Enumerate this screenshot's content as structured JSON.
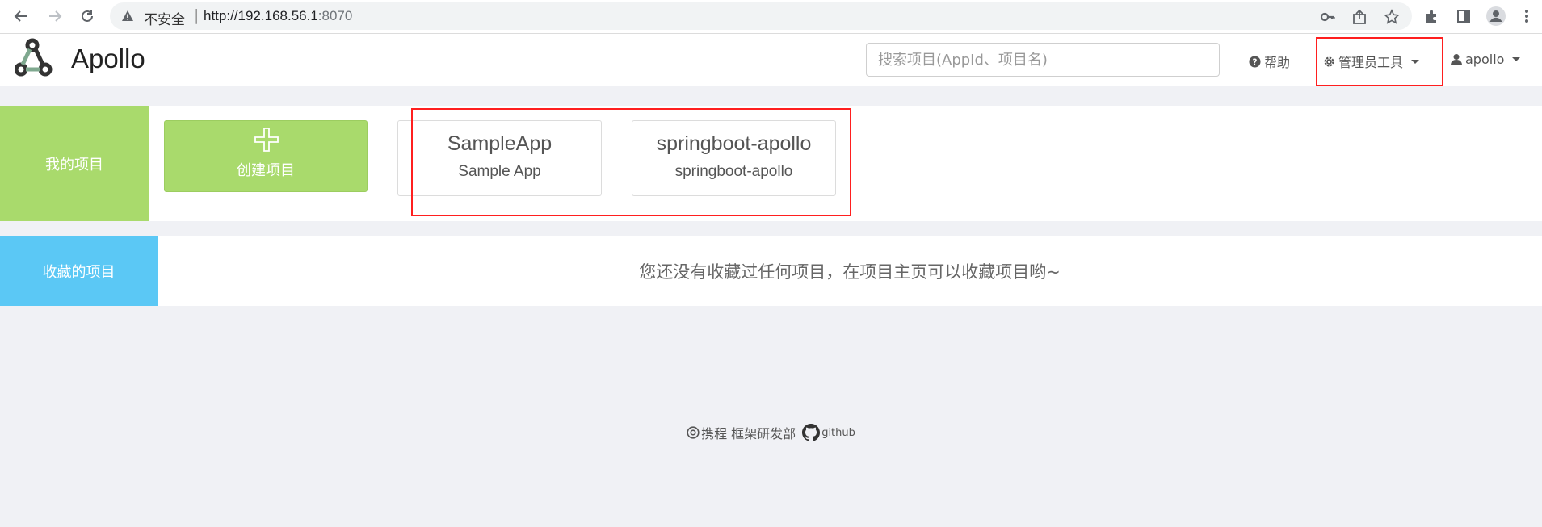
{
  "browser": {
    "security_label": "不安全",
    "separator": "|",
    "url_host": "http://192.168.56.1",
    "url_port": ":8070"
  },
  "navbar": {
    "logo_text": "Apollo",
    "search_placeholder": "搜索项目(AppId、项目名)",
    "help_label": "帮助",
    "admin_tools_label": "管理员工具",
    "user_label": "apollo"
  },
  "my_projects": {
    "label": "我的项目",
    "label_color": "#a9da6c",
    "create_label": "创建项目",
    "apps": [
      {
        "name": "SampleApp",
        "description": "Sample App"
      },
      {
        "name": "springboot-apollo",
        "description": "springboot-apollo"
      }
    ]
  },
  "favorites": {
    "label": "收藏的项目",
    "label_color": "#5bc8f5",
    "empty_message": "您还没有收藏过任何项目，在项目主页可以收藏项目哟~"
  },
  "footer": {
    "copyright": "携程 框架研发部",
    "github_label": "github"
  },
  "annotation_color": "#ff1f1f"
}
